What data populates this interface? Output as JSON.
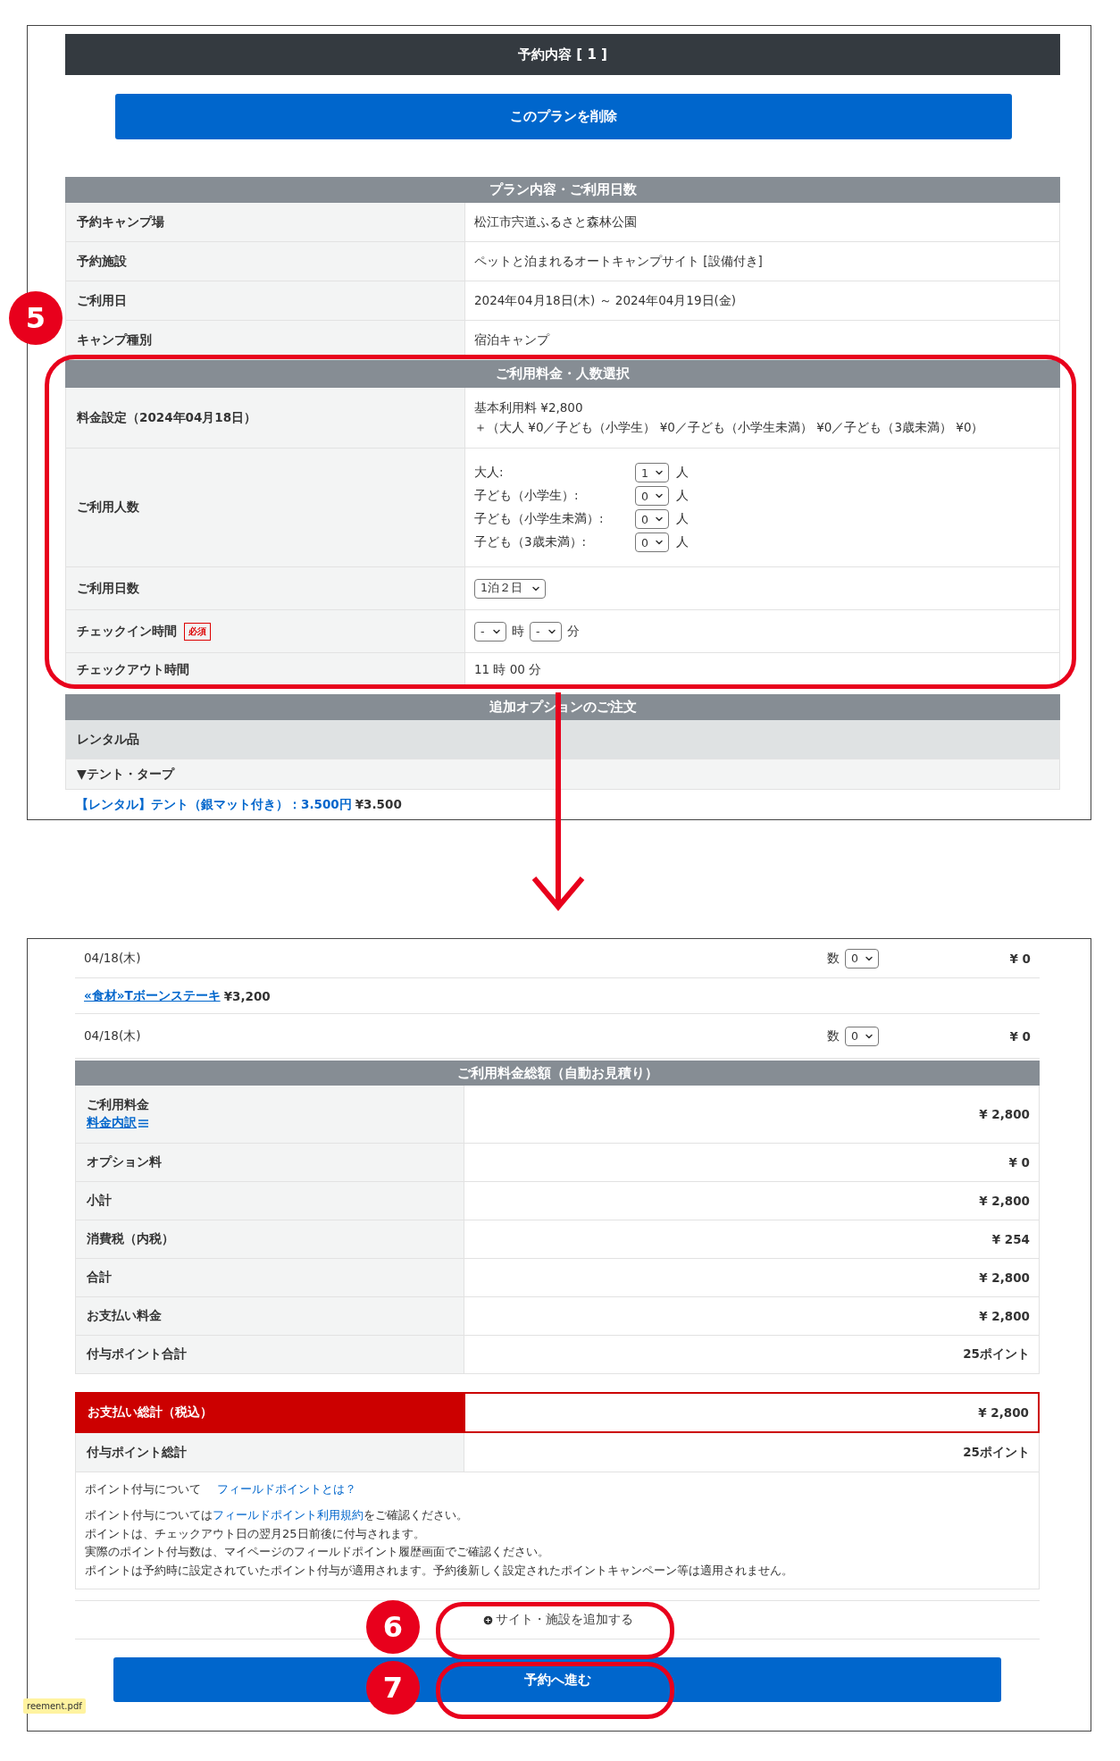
{
  "reservation_header": "予約内容 [ 1 ]",
  "delete_button": "このプランを削除",
  "plan_section": {
    "title": "プラン内容・ご利用日数",
    "rows": [
      {
        "label": "予約キャンプ場",
        "value": "松江市宍道ふるさと森林公園"
      },
      {
        "label": "予約施設",
        "value": "ペットと泊まれるオートキャンプサイト [設備付き]"
      },
      {
        "label": "ご利用日",
        "value": "2024年04月18日(木) ～ 2024年04月19日(金)"
      },
      {
        "label": "キャンプ種別",
        "value": "宿泊キャンプ"
      }
    ]
  },
  "fee_section": {
    "title": "ご利用料金・人数選択",
    "rows": [
      {
        "kind": "text",
        "label": "料金設定（2024年04月18日）",
        "lines": [
          "基本利用料 ¥2,800",
          "＋（大人 ¥0／子ども（小学生） ¥0／子ども（小学生未満） ¥0／子ども（3歳未満） ¥0）"
        ]
      },
      {
        "kind": "people",
        "label": "ご利用人数",
        "people": [
          {
            "label": "大人:",
            "value": "1",
            "unit": "人"
          },
          {
            "label": "子ども（小学生）:",
            "value": "0",
            "unit": "人"
          },
          {
            "label": "子ども（小学生未満）:",
            "value": "0",
            "unit": "人"
          },
          {
            "label": "子ども（3歳未満）:",
            "value": "0",
            "unit": "人"
          }
        ]
      },
      {
        "kind": "select",
        "label": "ご利用日数",
        "value": "1泊２日"
      },
      {
        "kind": "time",
        "label": "チェックイン時間",
        "required": "必須",
        "hour": "-",
        "hour_unit": "時",
        "minute": "-",
        "minute_unit": "分"
      },
      {
        "kind": "text",
        "label": "チェックアウト時間",
        "lines": [
          "11 時 00 分"
        ]
      }
    ]
  },
  "options_section": {
    "title": "追加オプションのご注文",
    "category": "レンタル品",
    "group": "▼テント・タープ",
    "item_link": "【レンタル】テント（銀マット付き）：3.500円",
    "item_price": "¥3.500"
  },
  "option_rows": [
    {
      "kind": "order",
      "date": "04/18(木)",
      "qty_label": "数",
      "qty": "0",
      "price": "¥ 0"
    },
    {
      "kind": "item",
      "link": "«食材»Tボーンステーキ",
      "price": "¥3,200"
    },
    {
      "kind": "order",
      "date": "04/18(木)",
      "qty_label": "数",
      "qty": "0",
      "price": "¥ 0"
    }
  ],
  "totals": {
    "title": "ご利用料金総額（自動お見積り）",
    "rows": [
      {
        "label": "ご利用料金",
        "link": "料金内訳",
        "value": "¥ 2,800"
      },
      {
        "label": "オプション料",
        "value": "¥ 0"
      },
      {
        "label": "小計",
        "value": "¥ 2,800"
      },
      {
        "label": "消費税（内税）",
        "value": "¥ 254"
      },
      {
        "label": "合計",
        "value": "¥ 2,800"
      },
      {
        "label": "お支払い料金",
        "value": "¥ 2,800"
      },
      {
        "label": "付与ポイント合計",
        "value": "25ポイント"
      }
    ]
  },
  "grand_total": {
    "label": "お支払い総計（税込）",
    "value": "¥ 2,800"
  },
  "points_total": {
    "label": "付与ポイント総計",
    "value": "25ポイント"
  },
  "notes": {
    "heading": "ポイント付与について",
    "heading_link": "フィールドポイントとは？",
    "lines": [
      {
        "kind": "link",
        "before": "ポイント付与については",
        "link": "フィールドポイント利用規約",
        "after": "をご確認ください。"
      },
      {
        "kind": "plain",
        "text": "ポイントは、チェックアウト日の翌月25日前後に付与されます。"
      },
      {
        "kind": "plain",
        "text": "実際のポイント付与数は、マイページのフィールドポイント履歴画面でご確認ください。"
      },
      {
        "kind": "plain",
        "text": "ポイントは予約時に設定されていたポイント付与が適用されます。予約後新しく設定されたポイントキャンペーン等は適用されません。"
      }
    ]
  },
  "add_site_button": "サイト・施設を追加する",
  "proceed_button": "予約へ進む",
  "annotations": [
    {
      "number": "5"
    },
    {
      "number": "6"
    },
    {
      "number": "7"
    }
  ],
  "download_chip": "reement.pdf"
}
